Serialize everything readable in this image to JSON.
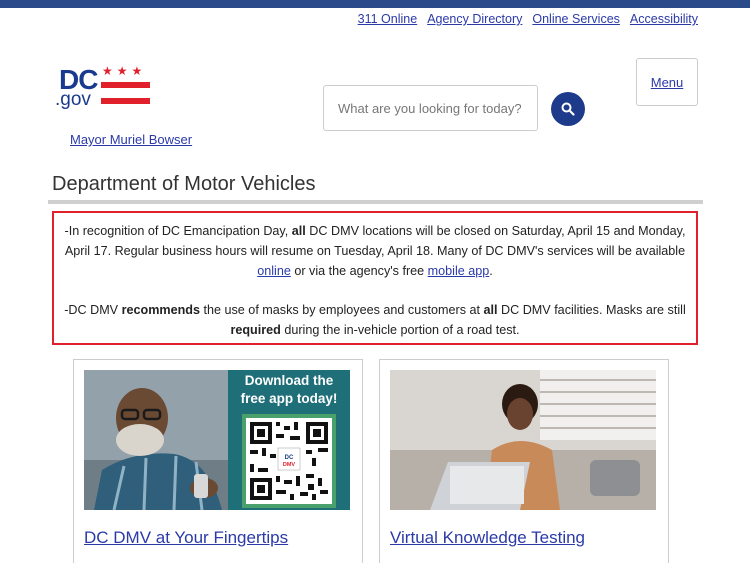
{
  "utility_nav": [
    "311 Online",
    "Agency Directory",
    "Online Services",
    "Accessibility"
  ],
  "logo": {
    "dc": "DC",
    "gov": ".gov",
    "stars": "★★★"
  },
  "mayor_link": "Mayor Muriel Bowser",
  "search": {
    "placeholder": "What are you looking for today?"
  },
  "menu_label": "Menu",
  "page_title": "Department of Motor Vehicles",
  "alert": {
    "p1_a": "-In recognition of DC Emancipation Day, ",
    "p1_b": "all",
    "p1_c": " DC DMV locations will be closed on Saturday, April 15 and Monday, April 17. Regular business hours will resume on Tuesday, April 18. Many of DC DMV's services will be available ",
    "p1_link1": "online",
    "p1_d": " or via the agency's free ",
    "p1_link2": "mobile app",
    "p1_e": ".",
    "p2_a": "-DC DMV ",
    "p2_b": "recommends",
    "p2_c": " the use of masks by employees and customers at ",
    "p2_d": "all",
    "p2_e": " DC DMV facilities. Masks are still ",
    "p2_f": "required",
    "p2_g": " during the in-vehicle portion of a road test."
  },
  "cards": [
    {
      "title": "DC DMV at Your Fingertips",
      "promo_line1": "Download the",
      "promo_line2": "free app today!"
    },
    {
      "title": "Virtual Knowledge Testing"
    }
  ],
  "colors": {
    "brand_blue": "#1e3a8a",
    "alert_red": "#e0202a",
    "link": "#2b3aa8"
  }
}
